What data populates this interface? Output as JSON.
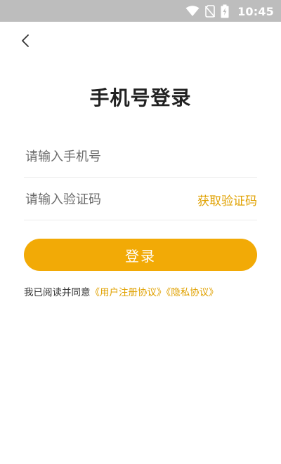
{
  "status_bar": {
    "time": "10:45",
    "icons": [
      "wifi-icon",
      "no-sim-icon",
      "battery-charging-icon"
    ]
  },
  "header": {
    "back_icon": "chevron-left-icon"
  },
  "title": "手机号登录",
  "form": {
    "phone": {
      "value": "",
      "placeholder": "请输入手机号"
    },
    "code": {
      "value": "",
      "placeholder": "请输入验证码"
    },
    "get_code_label": "获取验证码",
    "login_label": "登录"
  },
  "agreement": {
    "prefix": "我已阅读并同意",
    "user_agreement": "《用户注册协议》",
    "privacy_policy": "《隐私协议》"
  },
  "colors": {
    "accent": "#f2aa06",
    "link": "#e0a100",
    "status_bar": "#bdbdbd"
  }
}
